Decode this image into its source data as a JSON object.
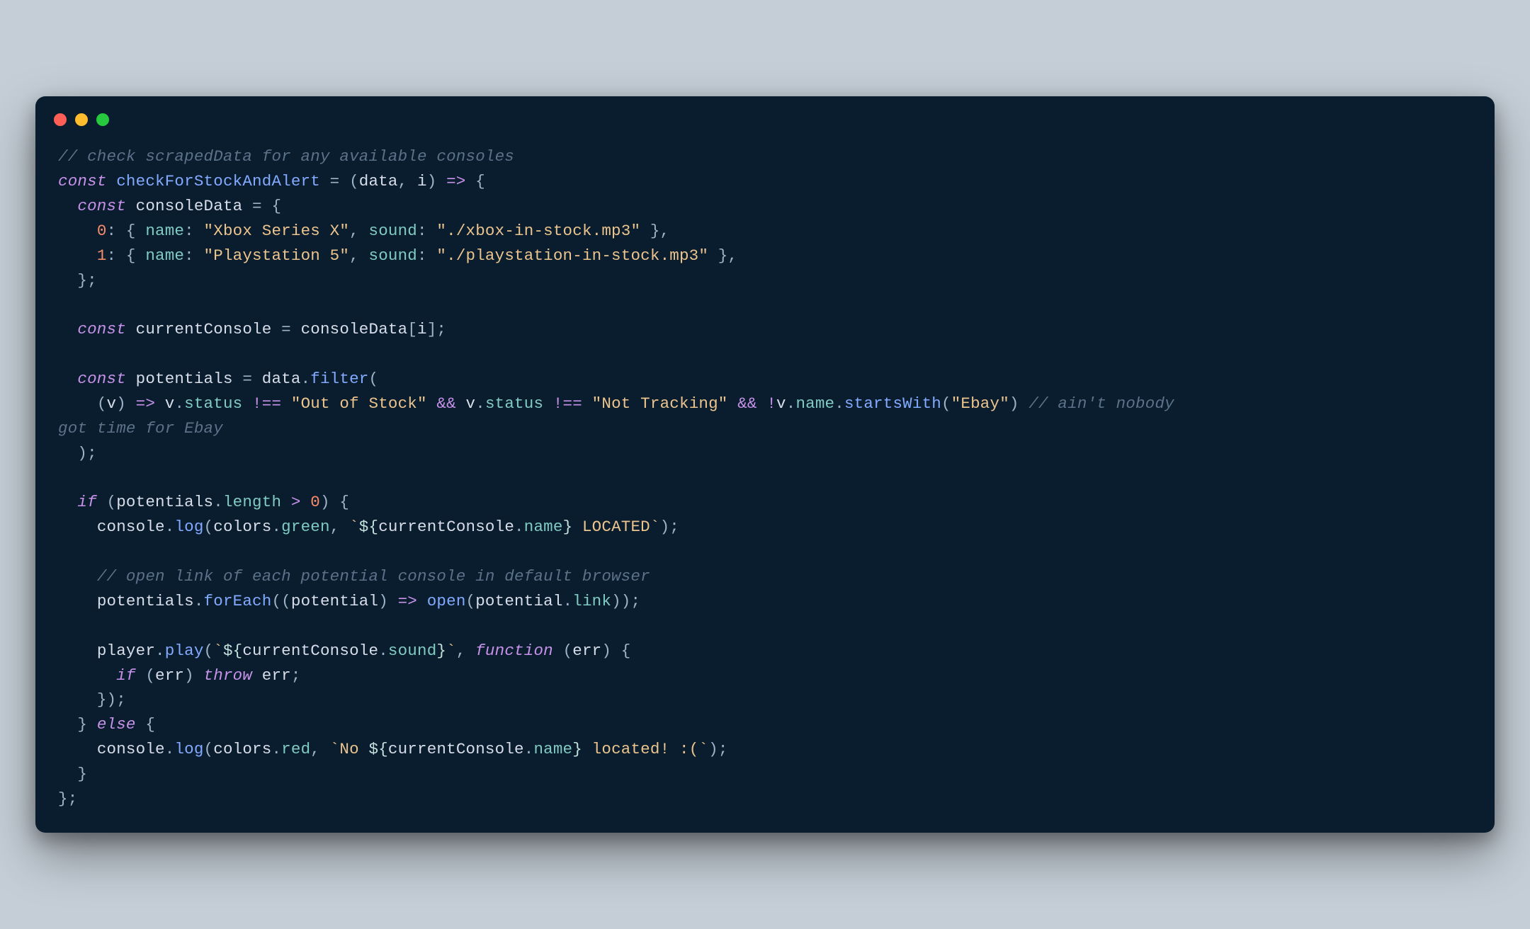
{
  "code": {
    "c1": "// check scrapedData for any available consoles",
    "kw_const": "const",
    "fn_name": "checkForStockAndAlert",
    "eq": " = ",
    "open_paren": "(",
    "p_data": "data",
    "comma_sp": ", ",
    "p_i": "i",
    "close_paren": ")",
    "arrow": " => ",
    "open_brace": "{",
    "close_brace": "}",
    "semicolon": ";",
    "ind1": "  ",
    "ind2": "    ",
    "ind3": "      ",
    "consoleData": "consoleData",
    "k0": "0",
    "k1": "1",
    "colon_sp": ": ",
    "name_key": "name",
    "sound_key": "sound",
    "xbox_name": "\"Xbox Series X\"",
    "xbox_sound": "\"./xbox-in-stock.mp3\"",
    "ps_name": "\"Playstation 5\"",
    "ps_sound": "\"./playstation-in-stock.mp3\"",
    "currentConsole": "currentConsole",
    "eq_sp": " = ",
    "open_br": "[",
    "close_br": "]",
    "potentials": "potentials",
    "data_var": "data",
    "dot": ".",
    "filter": "filter",
    "v": "v",
    "status": "status",
    "neq": " !== ",
    "out_of_stock": "\"Out of Stock\"",
    "and": " && ",
    "not_tracking": "\"Not Tracking\"",
    "bang": "!",
    "name_prop": "name",
    "startsWith": "startsWith",
    "ebay": "\"Ebay\"",
    "c2a": "// ain't nobody ",
    "c2b": "got time for Ebay",
    "if": "if",
    "length": "length",
    "gt": " > ",
    "zero": "0",
    "console": "console",
    "log": "log",
    "colors": "colors",
    "green": "green",
    "backtick": "`",
    "dollar_open": "${",
    "close_curly": "}",
    "located": " LOCATED",
    "c3": "// open link of each potential console in default browser",
    "forEach": "forEach",
    "potential": "potential",
    "open_fn": "open",
    "link": "link",
    "player": "player",
    "play": "play",
    "sound_prop": "sound",
    "function": "function",
    "err": "err",
    "throw": "throw",
    "else": "else",
    "red": "red",
    "no_prefix": "No ",
    "located_fail": " located! :("
  }
}
